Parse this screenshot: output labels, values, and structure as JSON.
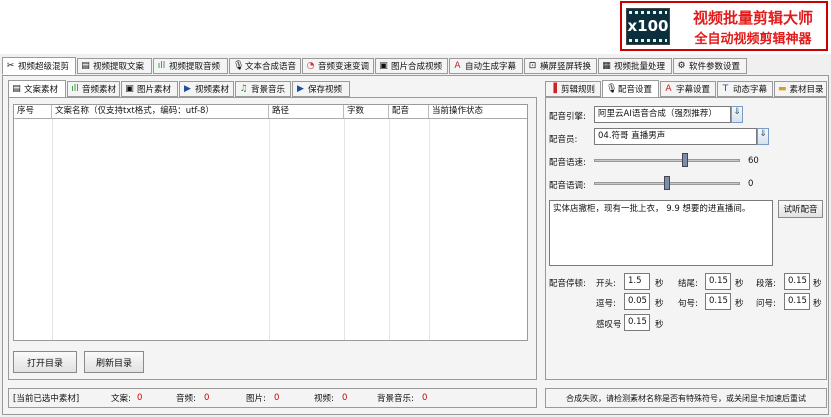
{
  "brand": {
    "logo_text": "x100",
    "title": "视频批量剪辑大师",
    "subtitle": "全自动视频剪辑神器"
  },
  "main_tabs": [
    {
      "label": "视频超级混剪",
      "icon": "scissors-icon",
      "active": true
    },
    {
      "label": "视频提取文案",
      "icon": "document-icon"
    },
    {
      "label": "视频提取音频",
      "icon": "audio-wave-icon"
    },
    {
      "label": "文本合成语音",
      "icon": "microphone-icon"
    },
    {
      "label": "音频变速变调",
      "icon": "gauge-icon"
    },
    {
      "label": "图片合成视频",
      "icon": "image-icon"
    },
    {
      "label": "自动生成字幕",
      "icon": "text-a-icon"
    },
    {
      "label": "横屏竖屏转换",
      "icon": "rotate-screen-icon"
    },
    {
      "label": "视频批量处理",
      "icon": "film-icon"
    },
    {
      "label": "软件参数设置",
      "icon": "gear-icon"
    }
  ],
  "left_tabs": [
    {
      "label": "文案素材",
      "icon": "document-icon",
      "active": true
    },
    {
      "label": "音频素材",
      "icon": "audio-wave-icon"
    },
    {
      "label": "图片素材",
      "icon": "image-icon"
    },
    {
      "label": "视频素材",
      "icon": "play-icon"
    },
    {
      "label": "背景音乐",
      "icon": "music-note-icon"
    },
    {
      "label": "保存视频",
      "icon": "save-video-icon"
    }
  ],
  "table": {
    "columns": [
      "序号",
      "文案名称（仅支持txt格式，编码：utf-8）",
      "路径",
      "字数",
      "配音",
      "当前操作状态"
    ]
  },
  "left_buttons": {
    "open_dir": "打开目录",
    "refresh_dir": "刷新目录"
  },
  "right_tabs": [
    {
      "label": "剪辑规则",
      "icon": "rule-icon"
    },
    {
      "label": "配音设置",
      "icon": "microphone-icon",
      "active": true
    },
    {
      "label": "字幕设置",
      "icon": "text-a-icon"
    },
    {
      "label": "动态字幕",
      "icon": "subtitle-t-icon"
    },
    {
      "label": "素材目录",
      "icon": "folder-icon"
    }
  ],
  "voice": {
    "engine_label": "配音引擎:",
    "engine_value": "阿里云AI语音合成（强烈推荐）",
    "speaker_label": "配音员:",
    "speaker_value": "04.符哥 直播男声",
    "speed_label": "配音语速:",
    "speed_value": "60",
    "speed_level": 0.62,
    "pitch_label": "配音语调:",
    "pitch_value": "0",
    "pitch_level": 0.5,
    "sample_text": "实体店撤柜，现有一批上衣， 9.9 想要的进直播间。",
    "preview_button": "试听配音",
    "pause_label": "配音停顿:",
    "pauses": {
      "start_label": "开头:",
      "start_value": "1.5",
      "end_label": "结尾:",
      "end_value": "0.15",
      "para_label": "段落:",
      "para_value": "0.15",
      "comma_label": "逗号:",
      "comma_value": "0.05",
      "period_label": "句号:",
      "period_value": "0.15",
      "question_label": "问号:",
      "question_value": "0.15",
      "exclaim_label": "感叹号",
      "exclaim_value": "0.15",
      "unit": "秒"
    }
  },
  "status_left": {
    "selected": "[当前已选中素材]",
    "text_label": "文案:",
    "text_count": "0",
    "audio_label": "音频:",
    "audio_count": "0",
    "image_label": "图片:",
    "image_count": "0",
    "video_label": "视频:",
    "video_count": "0",
    "music_label": "背景音乐:",
    "music_count": "0"
  },
  "status_right": "合成失败，请检测素材名称是否有特殊符号，或关闭显卡加速后重试",
  "colors": {
    "brand_red": "#e21b1b",
    "count_red": "#d00000",
    "logo_bg": "#0c2f3d"
  }
}
